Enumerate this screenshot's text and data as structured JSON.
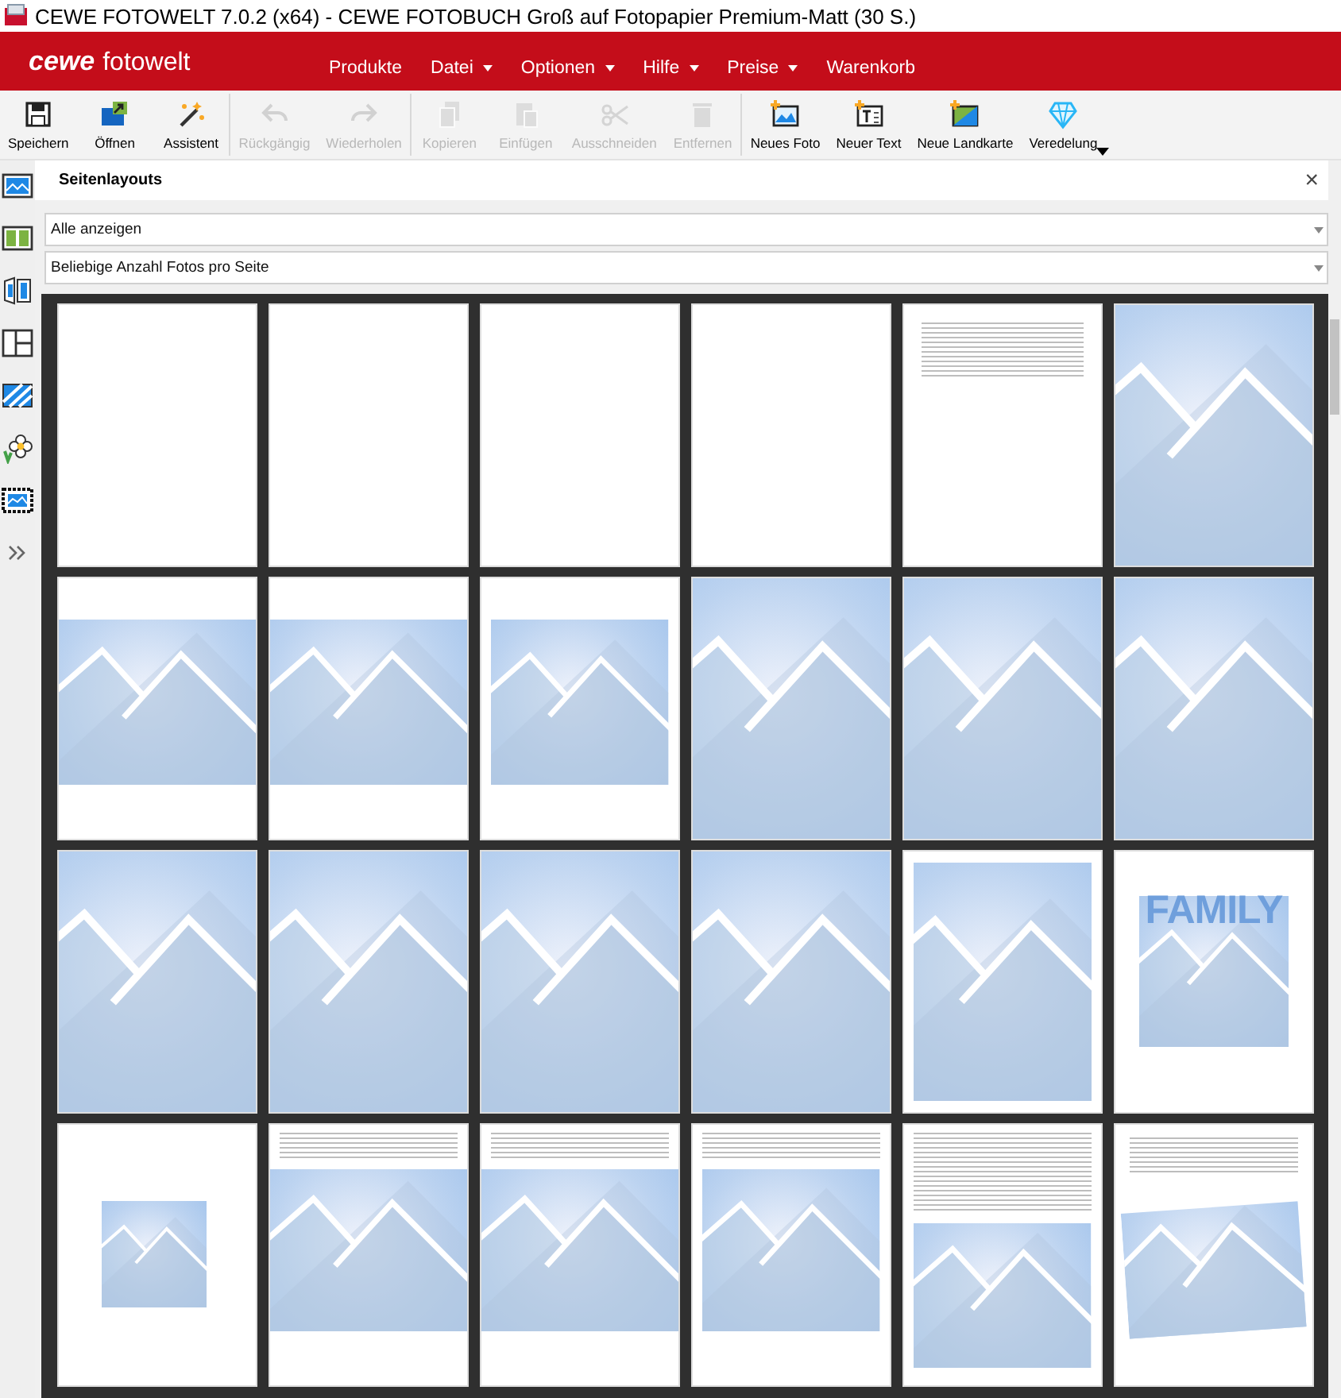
{
  "window": {
    "title": "CEWE FOTOWELT 7.0.2 (x64) - CEWE FOTOBUCH Groß auf Fotopapier Premium-Matt (30 S.)"
  },
  "logo": {
    "brand": "cewe",
    "name": "fotowelt"
  },
  "menu": [
    {
      "label": "Produkte",
      "has_menu": false
    },
    {
      "label": "Datei",
      "has_menu": true
    },
    {
      "label": "Optionen",
      "has_menu": true
    },
    {
      "label": "Hilfe",
      "has_menu": true
    },
    {
      "label": "Preise",
      "has_menu": true
    },
    {
      "label": "Warenkorb",
      "has_menu": false
    }
  ],
  "toolbar": [
    [
      {
        "kind": "save",
        "label": "Speichern",
        "disabled": false
      },
      {
        "kind": "open",
        "label": "Öffnen",
        "disabled": false
      },
      {
        "kind": "wizard",
        "label": "Assistent",
        "disabled": false
      }
    ],
    [
      {
        "kind": "undo",
        "label": "Rückgängig",
        "disabled": true
      },
      {
        "kind": "redo",
        "label": "Wiederholen",
        "disabled": true
      }
    ],
    [
      {
        "kind": "copy",
        "label": "Kopieren",
        "disabled": true
      },
      {
        "kind": "paste",
        "label": "Einfügen",
        "disabled": true
      },
      {
        "kind": "cut",
        "label": "Ausschneiden",
        "disabled": true
      },
      {
        "kind": "delete",
        "label": "Entfernen",
        "disabled": true
      }
    ],
    [
      {
        "kind": "photo",
        "label": "Neues Foto",
        "disabled": false,
        "has_menu": false
      },
      {
        "kind": "text",
        "label": "Neuer Text",
        "disabled": false,
        "has_menu": false
      },
      {
        "kind": "map",
        "label": "Neue Landkarte",
        "disabled": false,
        "has_menu": false
      },
      {
        "kind": "diamond",
        "label": "Veredelung",
        "disabled": false,
        "has_menu": true
      }
    ]
  ],
  "sidebar": {
    "items": [
      {
        "kind": "layouts"
      },
      {
        "kind": "spread"
      },
      {
        "kind": "page"
      },
      {
        "kind": "grid"
      },
      {
        "kind": "background"
      },
      {
        "kind": "clipart"
      },
      {
        "kind": "frame"
      },
      {
        "kind": "more"
      }
    ]
  },
  "panel": {
    "title": "Seitenlayouts",
    "close": "×",
    "filters": [
      {
        "value": "Alle anzeigen"
      },
      {
        "value": "Beliebige Anzahl Fotos pro Seite"
      }
    ],
    "layouts": [
      {
        "kind": "blank"
      },
      {
        "kind": "blank"
      },
      {
        "kind": "blank"
      },
      {
        "kind": "blank"
      },
      {
        "kind": "text"
      },
      {
        "kind": "photo-full"
      },
      {
        "kind": "photo-band"
      },
      {
        "kind": "photo-band"
      },
      {
        "kind": "photo-band-inset"
      },
      {
        "kind": "photo-full"
      },
      {
        "kind": "photo-full"
      },
      {
        "kind": "photo-full"
      },
      {
        "kind": "photo-full"
      },
      {
        "kind": "photo-full"
      },
      {
        "kind": "photo-full"
      },
      {
        "kind": "photo-full"
      },
      {
        "kind": "photo-framed"
      },
      {
        "kind": "title-photo",
        "title": "FAMILY"
      },
      {
        "kind": "photo-small"
      },
      {
        "kind": "text-photo"
      },
      {
        "kind": "text-photo"
      },
      {
        "kind": "text-photo-inset"
      },
      {
        "kind": "text-photo-framed"
      },
      {
        "kind": "text-photo-tilted"
      }
    ]
  }
}
